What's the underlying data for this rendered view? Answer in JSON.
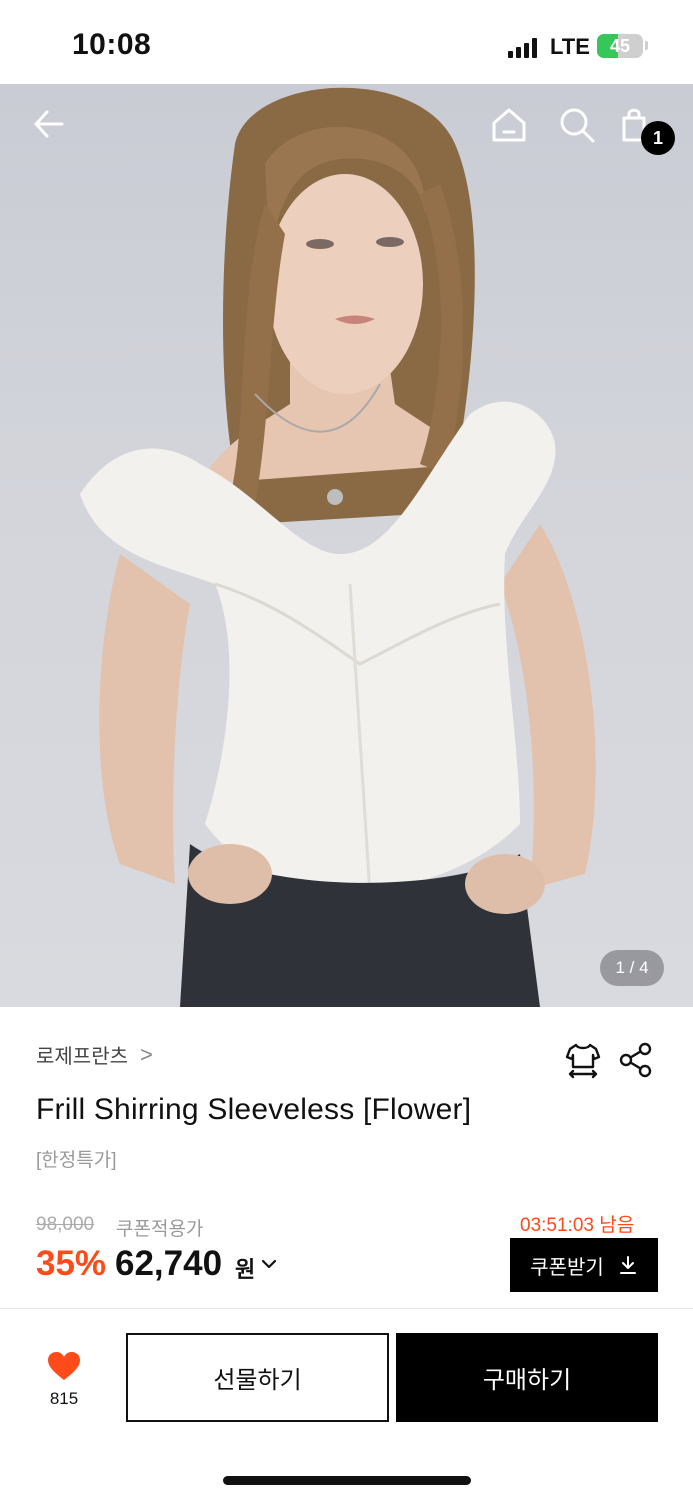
{
  "status_bar": {
    "time": "10:08",
    "network": "LTE",
    "battery": "45",
    "battery_level": 0.45
  },
  "header": {
    "cart_count": "1",
    "icons": [
      "back-arrow-icon",
      "home-icon",
      "search-icon",
      "shopping-bag-icon"
    ]
  },
  "gallery": {
    "indicator": "1 / 4"
  },
  "product": {
    "brand": "로제프란츠",
    "brand_chevron": ">",
    "name": "Frill Shirring Sleeveless [Flower]",
    "tag": "[한정특가]"
  },
  "pricing": {
    "original_price": "98,000",
    "coupon_label": "쿠폰적용가",
    "timer": "03:51:03 남음",
    "discount": "35%",
    "price": "62,740",
    "currency": "원",
    "coupon_button": "쿠폰받기"
  },
  "actions": {
    "like_count": "815",
    "gift_label": "선물하기",
    "buy_label": "구매하기"
  },
  "colors": {
    "accent": "#ff4a1a",
    "primary": "#000000",
    "battery_green": "#35c759"
  }
}
